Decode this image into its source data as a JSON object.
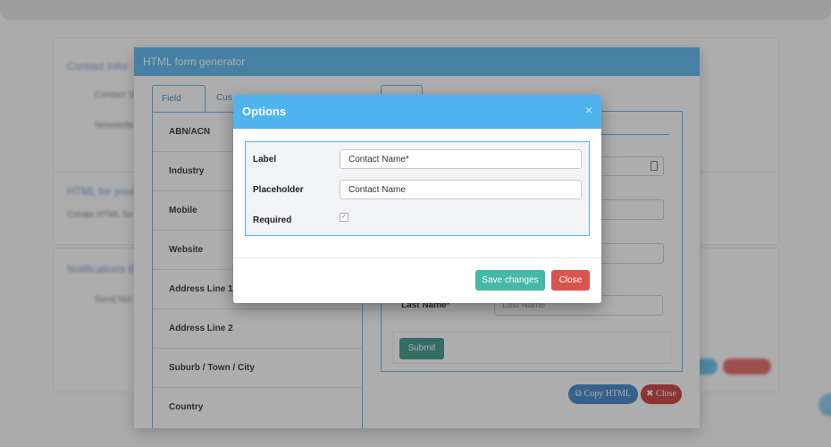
{
  "background": {
    "cards": [
      {
        "title": "Contact Infor",
        "lines": [
          "Contact Sh",
          "Newslette"
        ]
      },
      {
        "title": "HTML for your",
        "lines": [
          "Create HTML for yo"
        ]
      },
      {
        "title": "Notifications E",
        "lines": [
          "Send Not"
        ]
      }
    ]
  },
  "outer_modal": {
    "title": "HTML form generator",
    "tabs": [
      "Field List",
      "Cus"
    ],
    "fields": [
      "ABN/ACN",
      "Industry",
      "Mobile",
      "Website",
      "Address Line 1",
      "Address Line 2",
      "Suburb / Town / City",
      "Country"
    ],
    "preview": {
      "last_name_label": "Last Name*",
      "last_name_placeholder": "Last Name",
      "submit_label": "Submit"
    },
    "copy_html_label": "Copy HTML",
    "close_label": "Close"
  },
  "options_modal": {
    "title": "Options",
    "close_x": "×",
    "label_label": "Label",
    "label_value": "Contact Name*",
    "placeholder_label": "Placeholder",
    "placeholder_value": "Contact Name",
    "required_label": "Required",
    "required_checked": true,
    "save_label": "Save changes",
    "close_label": "Close"
  },
  "colors": {
    "header_blue": "#4fb3ee",
    "save_teal": "#45b8a6",
    "close_red": "#d9534f",
    "submit_teal": "#2f8f86",
    "copy_blue": "#2f7fc7"
  }
}
